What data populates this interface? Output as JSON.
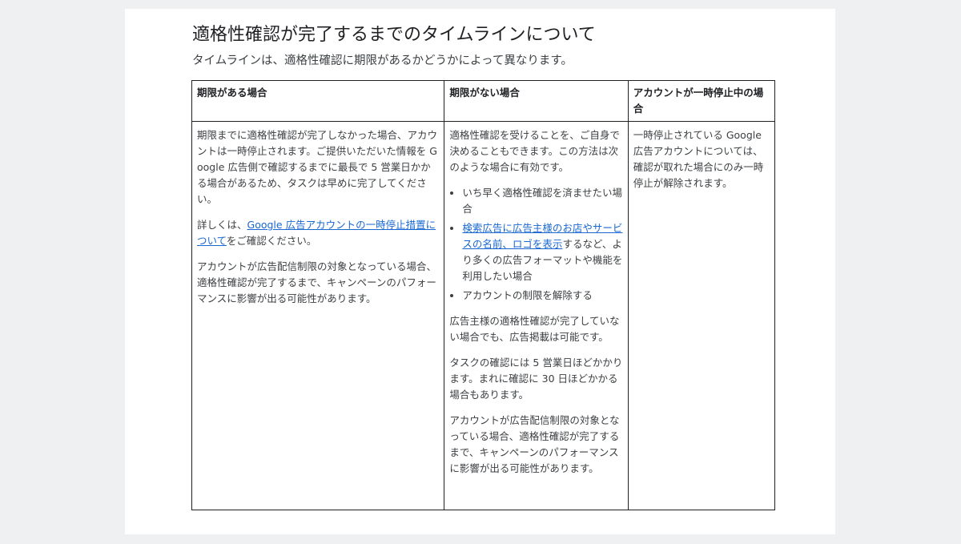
{
  "heading": "適格性確認が完了するまでのタイムラインについて",
  "subheading": "タイムラインは、適格性確認に期限があるかどうかによって異なります。",
  "table": {
    "headers": [
      "期限がある場合",
      "期限がない場合",
      "アカウントが一時停止中の場合"
    ],
    "col1": {
      "p1": "期限までに適格性確認が完了しなかった場合、アカウントは一時停止されます。ご提供いただいた情報を Google 広告側で確認するまでに最長で 5 営業日かかる場合があるため、タスクは早めに完了してください。",
      "p2_before": "詳しくは、",
      "p2_link": "Google 広告アカウントの一時停止措置について",
      "p2_after": "をご確認ください。",
      "p3": "アカウントが広告配信制限の対象となっている場合、適格性確認が完了するまで、キャンペーンのパフォーマンスに影響が出る可能性があります。"
    },
    "col2": {
      "p1": "適格性確認を受けることを、ご自身で決めることもできます。この方法は次のような場合に有効です。",
      "bullet1": "いち早く適格性確認を済ませたい場合",
      "bullet2_link": "検索広告に広告主様のお店やサービスの名前、ロゴを表示",
      "bullet2_after": "するなど、より多くの広告フォーマットや機能を利用したい場合",
      "bullet3": "アカウントの制限を解除する",
      "p2": "広告主様の適格性確認が完了していない場合でも、広告掲載は可能です。",
      "p3": "タスクの確認には 5 営業日ほどかかります。まれに確認に 30 日ほどかかる場合もあります。",
      "p4": "アカウントが広告配信制限の対象となっている場合、適格性確認が完了するまで、キャンペーンのパフォーマンスに影響が出る可能性があります。"
    },
    "col3": {
      "p1": "一時停止されている Google 広告アカウントについては、確認が取れた場合にのみ一時停止が解除されます。"
    }
  },
  "colors": {
    "page_background": "#eff0f2",
    "card_background": "#ffffff",
    "text": "#202124",
    "link": "#1967d2"
  }
}
